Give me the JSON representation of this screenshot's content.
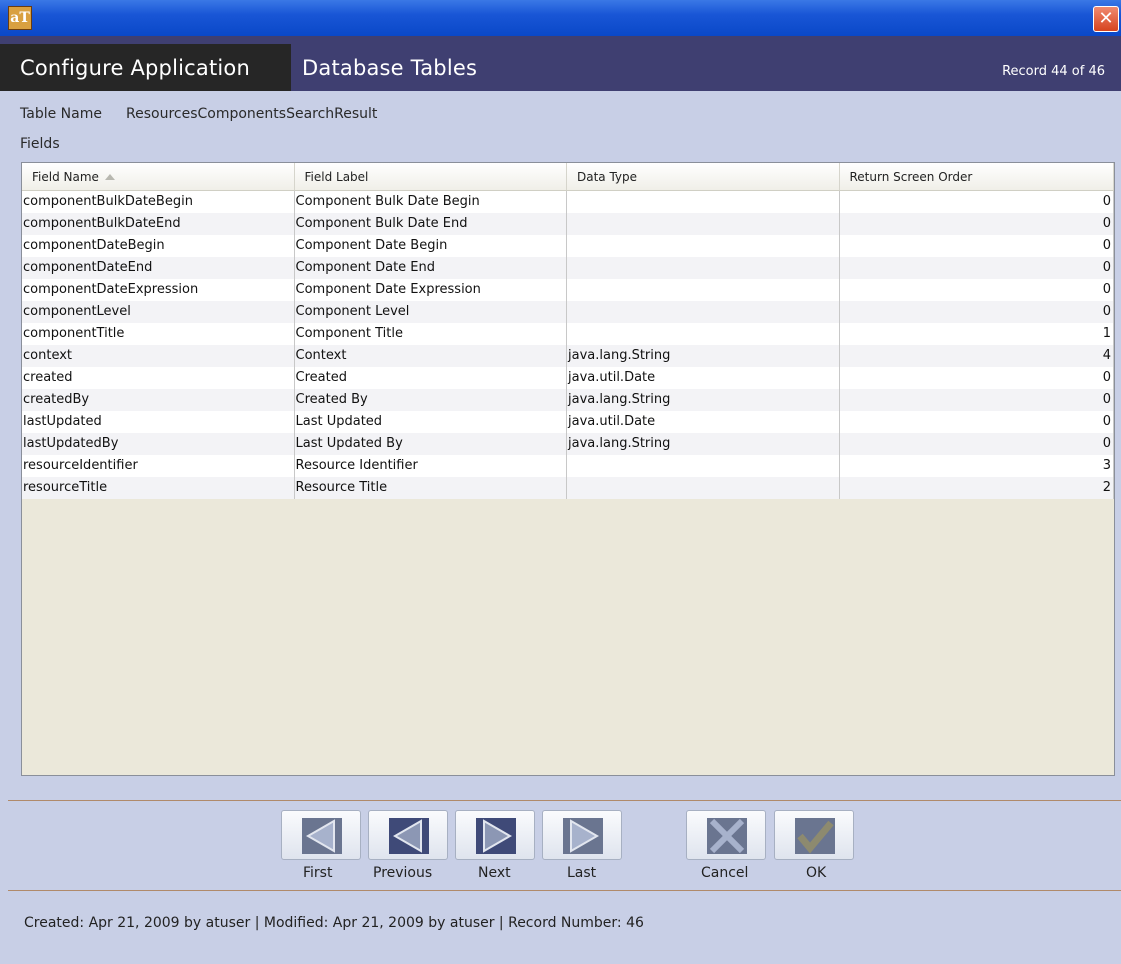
{
  "window": {
    "icon_text": "aT",
    "close_symbol": "✕"
  },
  "header": {
    "module": "Configure Application",
    "screen": "Database Tables",
    "record_indicator": "Record 44 of 46"
  },
  "form": {
    "table_name_label": "Table Name",
    "table_name_value": "ResourcesComponentsSearchResult",
    "fields_label": "Fields"
  },
  "grid": {
    "columns": [
      "Field Name",
      "Field Label",
      "Data Type",
      "Return Screen Order"
    ],
    "sorted_column": "Field Name",
    "rows": [
      [
        "componentBulkDateBegin",
        "Component Bulk Date Begin",
        "",
        "0"
      ],
      [
        "componentBulkDateEnd",
        "Component Bulk Date End",
        "",
        "0"
      ],
      [
        "componentDateBegin",
        "Component Date Begin",
        "",
        "0"
      ],
      [
        "componentDateEnd",
        "Component Date End",
        "",
        "0"
      ],
      [
        "componentDateExpression",
        "Component Date Expression",
        "",
        "0"
      ],
      [
        "componentLevel",
        "Component Level",
        "",
        "0"
      ],
      [
        "componentTitle",
        "Component Title",
        "",
        "1"
      ],
      [
        "context",
        "Context",
        "java.lang.String",
        "4"
      ],
      [
        "created",
        "Created",
        "java.util.Date",
        "0"
      ],
      [
        "createdBy",
        "Created By",
        "java.lang.String",
        "0"
      ],
      [
        "lastUpdated",
        "Last Updated",
        "java.util.Date",
        "0"
      ],
      [
        "lastUpdatedBy",
        "Last Updated By",
        "java.lang.String",
        "0"
      ],
      [
        "resourceIdentifier",
        "Resource Identifier",
        "",
        "3"
      ],
      [
        "resourceTitle",
        "Resource Title",
        "",
        "2"
      ]
    ]
  },
  "buttons": {
    "first": "First",
    "previous": "Previous",
    "next": "Next",
    "last": "Last",
    "cancel": "Cancel",
    "ok": "OK"
  },
  "status_bar": "Created: Apr 21, 2009 by atuser | Modified: Apr 21, 2009 by atuser | Record Number: 46",
  "colors": {
    "title_bar": "#1956d6",
    "header": "#3f3f71",
    "background": "#c8cfe6",
    "grid_empty": "#ebe8da"
  }
}
